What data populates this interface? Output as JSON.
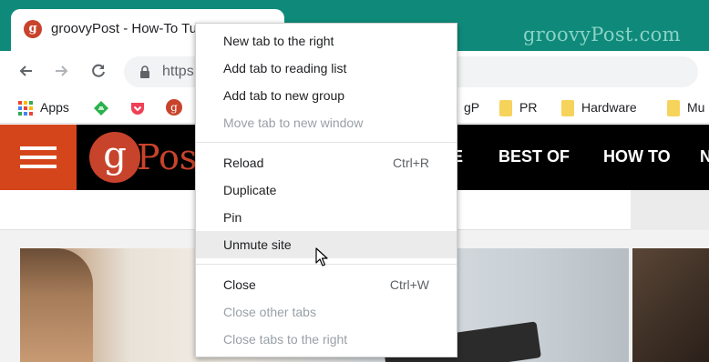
{
  "browser": {
    "tab": {
      "title": "groovyPost - How-To Tu",
      "favicon": "g"
    },
    "watermark": "groovyPost.com",
    "omnibox": {
      "url": "https://"
    },
    "bookmarks": [
      {
        "label": "Apps",
        "icon": "apps-grid-icon"
      },
      {
        "label": "",
        "icon": "feedly-icon"
      },
      {
        "label": "",
        "icon": "pocket-icon"
      },
      {
        "label": "",
        "icon": "groovypost-icon"
      },
      {
        "label": "gP",
        "icon": "folder-icon"
      },
      {
        "label": "PR",
        "icon": "folder-icon"
      },
      {
        "label": "Hardware",
        "icon": "folder-icon"
      },
      {
        "label": "Mu",
        "icon": "folder-icon"
      }
    ]
  },
  "site": {
    "logo_mark": "g",
    "logo_text": "Post",
    "menu": [
      "E",
      "BEST OF",
      "HOW TO",
      "N"
    ]
  },
  "context_menu": {
    "items": [
      {
        "label": "New tab to the right",
        "shortcut": "",
        "disabled": false
      },
      {
        "label": "Add tab to reading list",
        "shortcut": "",
        "disabled": false
      },
      {
        "label": "Add tab to new group",
        "shortcut": "",
        "disabled": false
      },
      {
        "label": "Move tab to new window",
        "shortcut": "",
        "disabled": true
      },
      {
        "label": "Reload",
        "shortcut": "Ctrl+R",
        "disabled": false
      },
      {
        "label": "Duplicate",
        "shortcut": "",
        "disabled": false
      },
      {
        "label": "Pin",
        "shortcut": "",
        "disabled": false
      },
      {
        "label": "Unmute site",
        "shortcut": "",
        "disabled": false,
        "hovered": true
      },
      {
        "label": "Close",
        "shortcut": "Ctrl+W",
        "disabled": false
      },
      {
        "label": "Close other tabs",
        "shortcut": "",
        "disabled": true
      },
      {
        "label": "Close tabs to the right",
        "shortcut": "",
        "disabled": true
      }
    ]
  },
  "colors": {
    "titlebar": "#0f8a7a",
    "brand_orange": "#d5451b",
    "brand_red": "#c8432b",
    "disabled_text": "#9aa0a6"
  }
}
